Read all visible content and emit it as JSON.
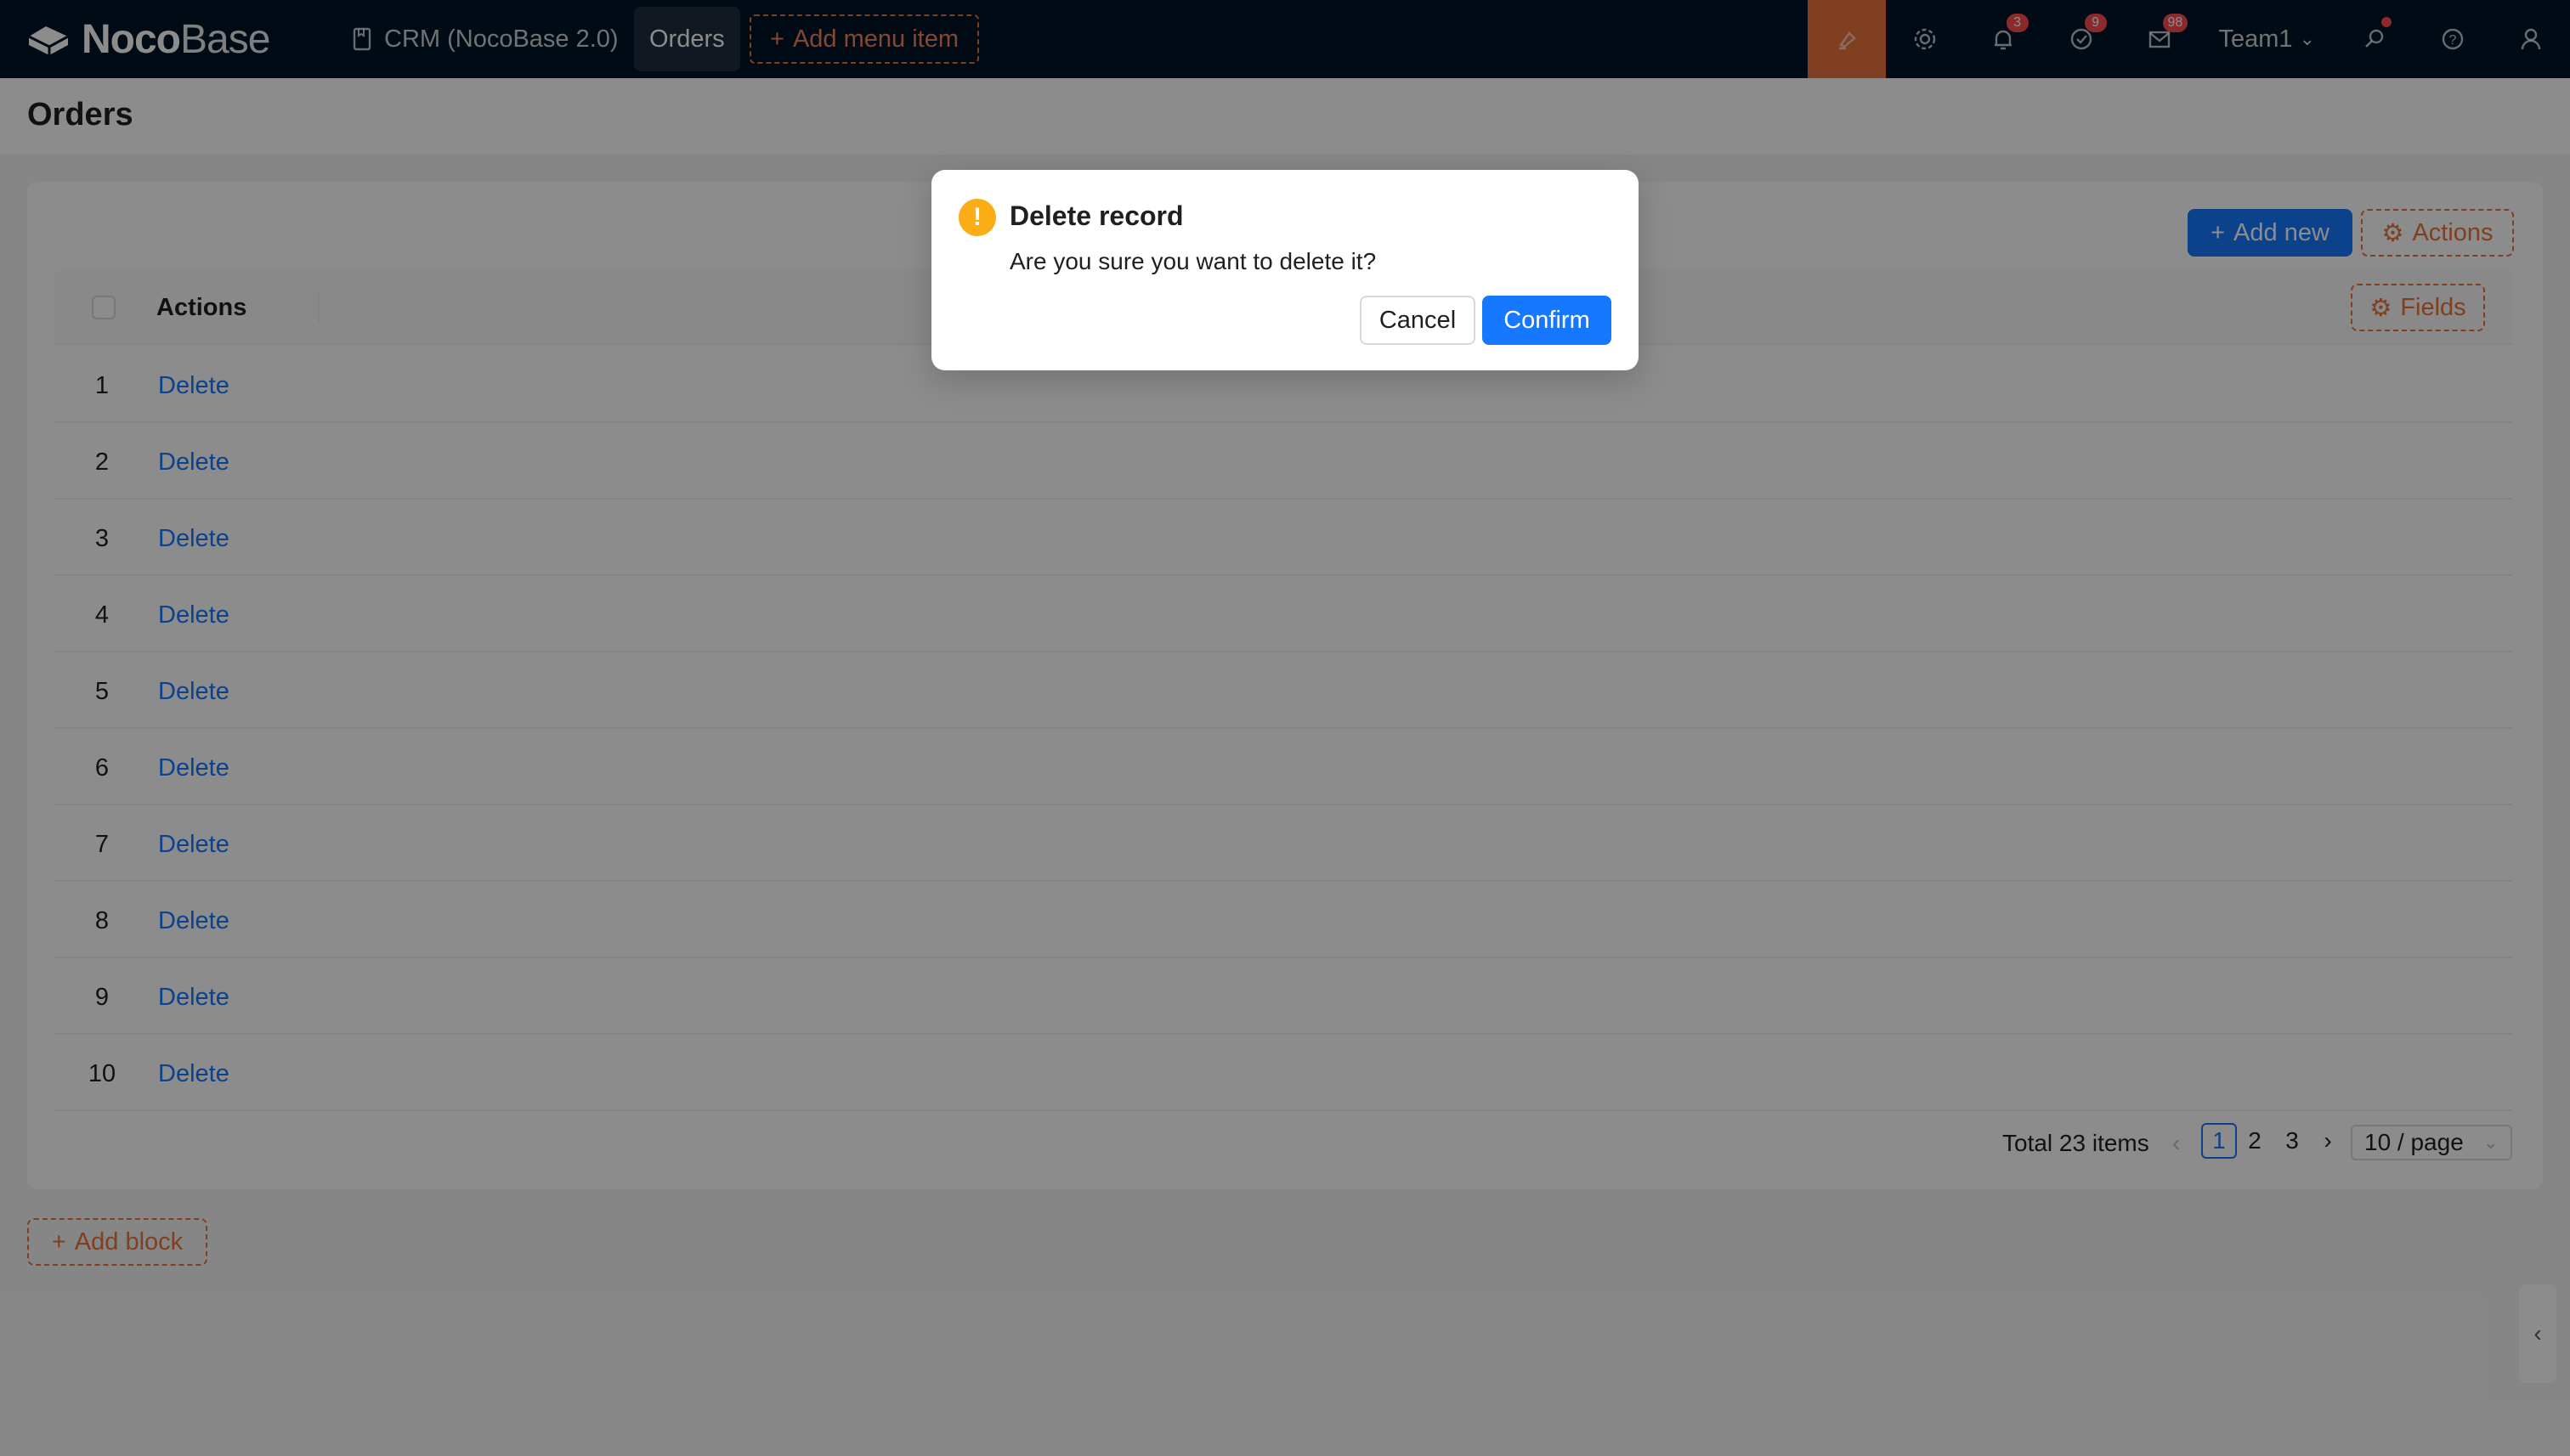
{
  "topbar": {
    "logo_bold": "Noco",
    "logo_thin": "Base",
    "menu": [
      {
        "label": "CRM (NocoBase 2.0)",
        "icon": "file-icon"
      },
      {
        "label": "Orders"
      }
    ],
    "add_menu_item": "Add menu item",
    "badges": {
      "notifications": "3",
      "tasks": "9",
      "messages": "98"
    },
    "team": "Team1"
  },
  "page": {
    "title": "Orders"
  },
  "toolbar": {
    "add_new": "Add new",
    "actions": "Actions",
    "fields": "Fields"
  },
  "table": {
    "header": {
      "actions": "Actions"
    },
    "rows": [
      {
        "num": "1",
        "action": "Delete"
      },
      {
        "num": "2",
        "action": "Delete"
      },
      {
        "num": "3",
        "action": "Delete"
      },
      {
        "num": "4",
        "action": "Delete"
      },
      {
        "num": "5",
        "action": "Delete"
      },
      {
        "num": "6",
        "action": "Delete"
      },
      {
        "num": "7",
        "action": "Delete"
      },
      {
        "num": "8",
        "action": "Delete"
      },
      {
        "num": "9",
        "action": "Delete"
      },
      {
        "num": "10",
        "action": "Delete"
      }
    ]
  },
  "pagination": {
    "total": "Total 23 items",
    "pages": [
      "1",
      "2",
      "3"
    ],
    "current": "1",
    "page_size": "10 / page"
  },
  "add_block": "Add block",
  "modal": {
    "title": "Delete record",
    "content": "Are you sure you want to delete it?",
    "cancel": "Cancel",
    "confirm": "Confirm"
  },
  "colors": {
    "primary": "#1677ff",
    "design_accent": "#e8743b",
    "warning": "#faad14",
    "header_bg": "#001529"
  }
}
